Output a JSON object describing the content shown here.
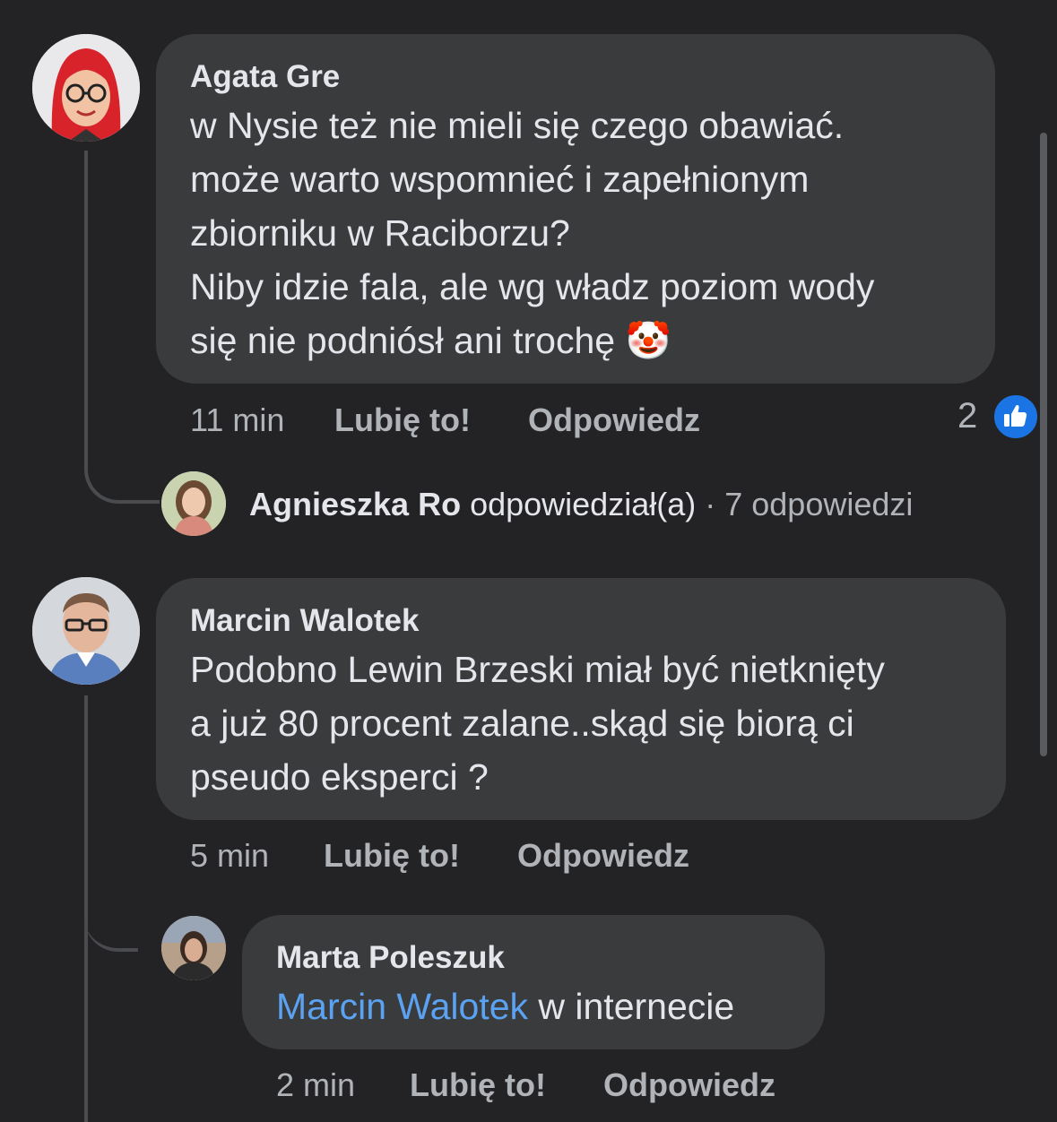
{
  "comments": [
    {
      "author": "Agata Gre",
      "text": "w Nysie też nie mieli się czego obawiać.\nmoże warto wspomnieć i zapełnionym\nzbiorniku w Raciborzu?\nNiby idzie fala, ale wg władz poziom wody\nsię nie podniósł ani trochę 🤡",
      "time": "11 min",
      "like_label": "Lubię to!",
      "reply_label": "Odpowiedz",
      "reactions_count": "2",
      "reply_summary": {
        "name": "Agnieszka Ro",
        "action": "odpowiedział(a)",
        "count_text": "· 7 odpowiedzi"
      }
    },
    {
      "author": "Marcin Walotek",
      "text": "Podobno Lewin Brzeski miał być nietknięty\na już 80 procent zalane..skąd się biorą ci\npseudo eksperci ?",
      "time": "5 min",
      "like_label": "Lubię to!",
      "reply_label": "Odpowiedz",
      "reply": {
        "author": "Marta Poleszuk",
        "mention": "Marcin Walotek",
        "text": " w internecie",
        "time": "2 min",
        "like_label": "Lubię to!",
        "reply_label": "Odpowiedz"
      }
    }
  ],
  "colors": {
    "background": "#232325",
    "bubble": "#3a3b3d",
    "mention": "#5ba3f2",
    "like_blue": "#1b74e4"
  }
}
